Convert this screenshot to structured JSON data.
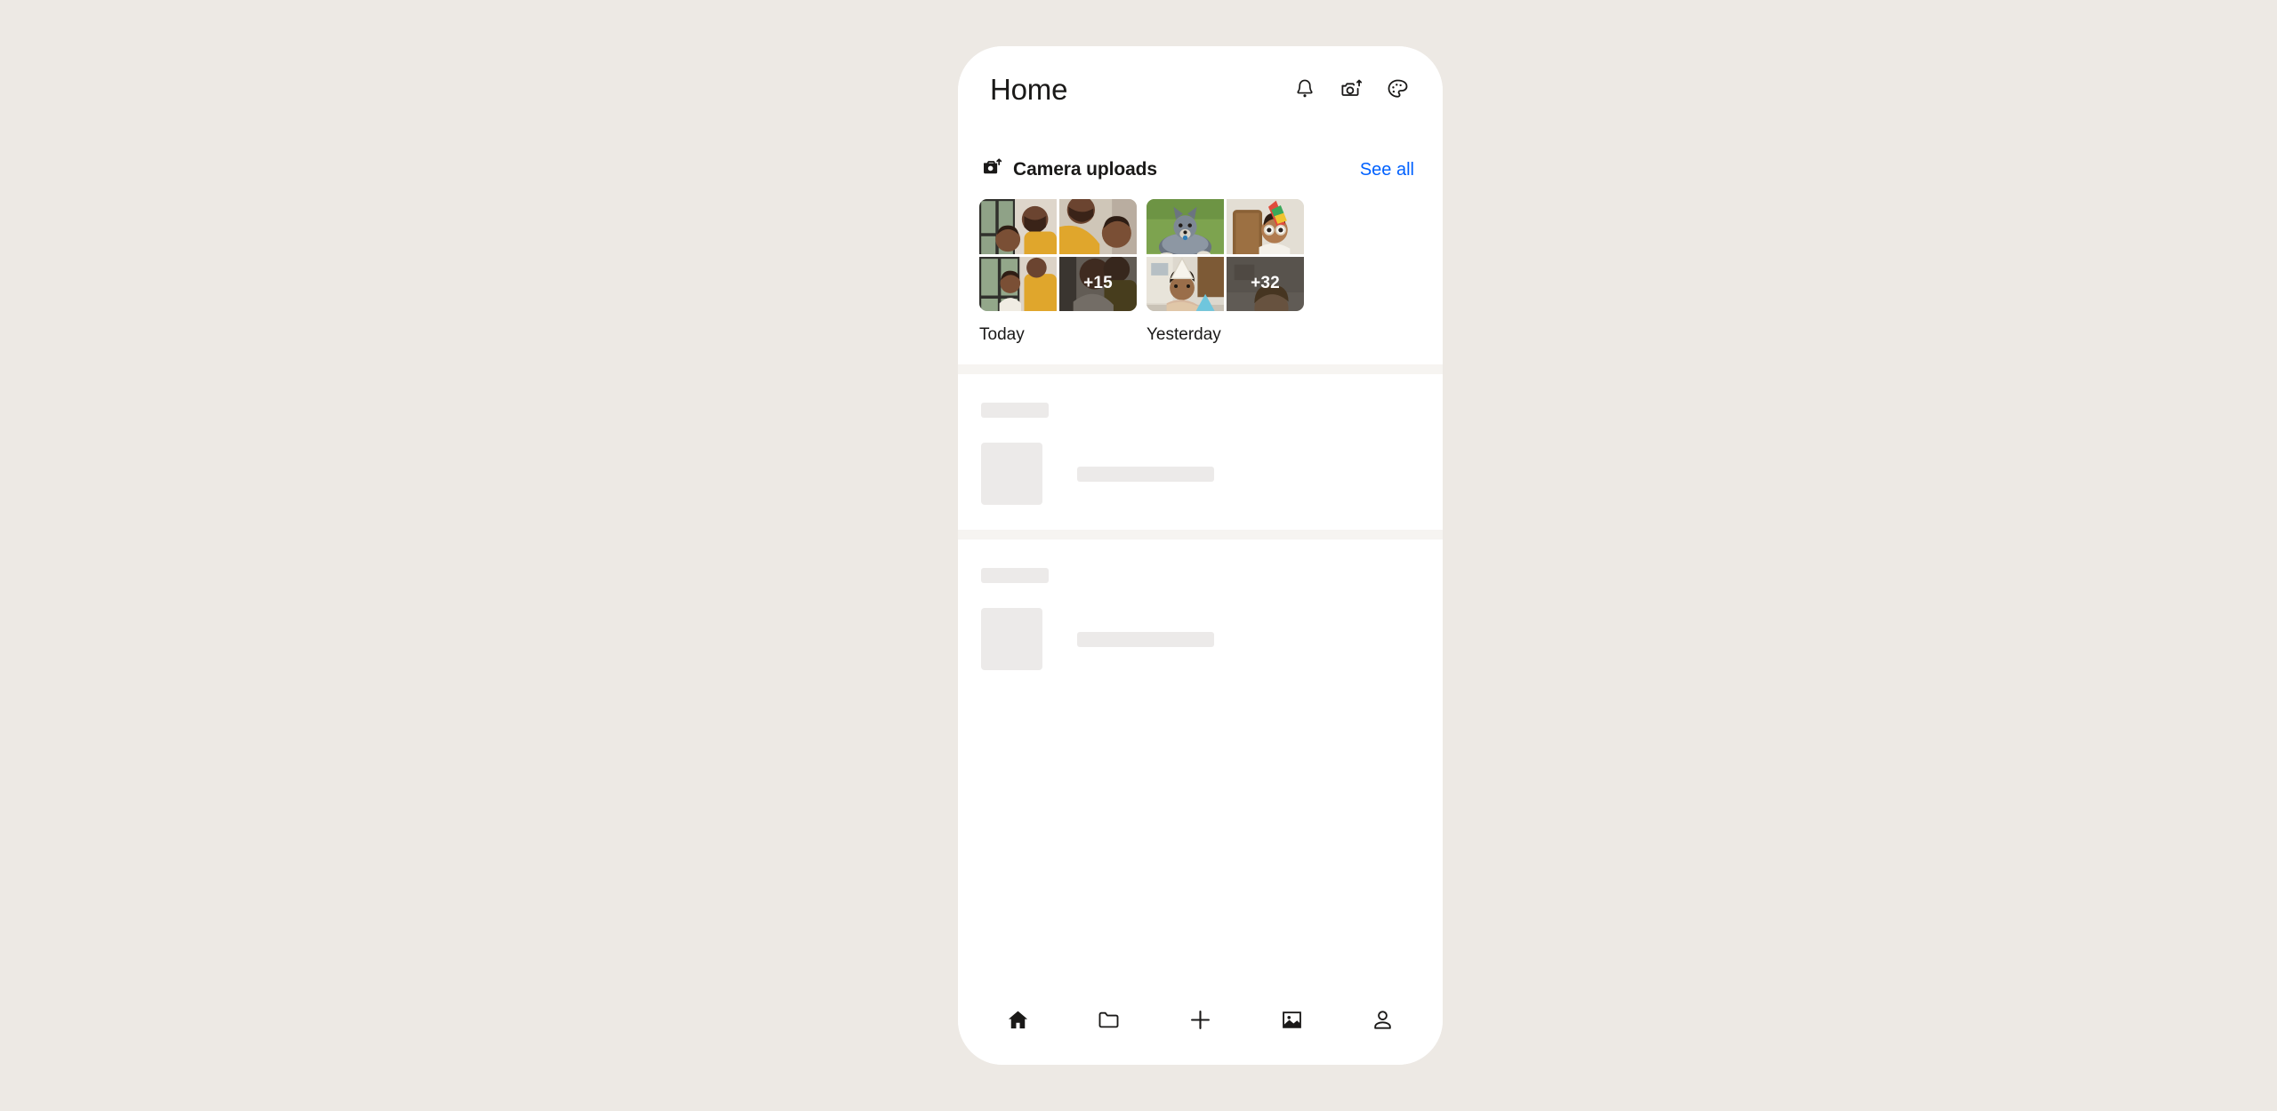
{
  "app": {
    "background_color": "#EDE9E4",
    "card_color": "#FFFFFF",
    "accent_color": "#0061FF",
    "text_color": "#1A1918",
    "skeleton_color": "#ECEAE9"
  },
  "header": {
    "title": "Home",
    "actions": [
      {
        "name": "notifications-bell-icon",
        "label": "Notifications"
      },
      {
        "name": "camera-upload-icon",
        "label": "Camera upload"
      },
      {
        "name": "palette-icon",
        "label": "Theme"
      }
    ]
  },
  "camera_uploads": {
    "icon": "camera-upload-icon",
    "title": "Camera uploads",
    "see_all_label": "See all",
    "groups": [
      {
        "label": "Today",
        "more_count": "+15",
        "tiles": [
          {
            "alt": "man and child smiling by window"
          },
          {
            "alt": "man in yellow sweater hugging child"
          },
          {
            "alt": "child held by man near window"
          },
          {
            "alt": "man and child, overlay more photos"
          }
        ]
      },
      {
        "label": "Yesterday",
        "more_count": "+32",
        "tiles": [
          {
            "alt": "blue heeler dog lying on grass"
          },
          {
            "alt": "child in party hat and novelty glasses"
          },
          {
            "alt": "girl in sequin dress at birthday party"
          },
          {
            "alt": "smiling girl, overlay more photos"
          }
        ]
      }
    ]
  },
  "skeleton_sections": [
    {
      "title_placeholder": "",
      "row_placeholder": ""
    },
    {
      "title_placeholder": "",
      "row_placeholder": ""
    }
  ],
  "bottom_nav": {
    "items": [
      {
        "name": "nav-home",
        "label": "Home",
        "icon": "home-icon",
        "active": true
      },
      {
        "name": "nav-files",
        "label": "Files",
        "icon": "folder-icon",
        "active": false
      },
      {
        "name": "nav-create",
        "label": "Create",
        "icon": "plus-icon",
        "active": false
      },
      {
        "name": "nav-photos",
        "label": "Photos",
        "icon": "image-icon",
        "active": false
      },
      {
        "name": "nav-account",
        "label": "Account",
        "icon": "person-icon",
        "active": false
      }
    ]
  }
}
